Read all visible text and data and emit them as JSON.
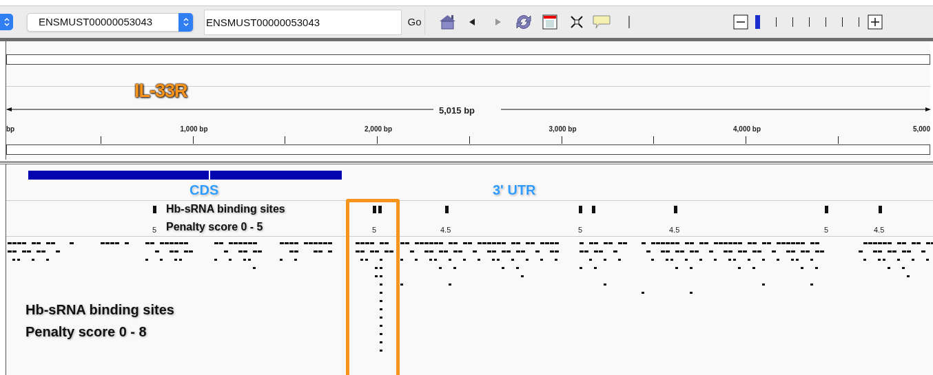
{
  "toolbar": {
    "locus_select": "ENSMUST00000053043",
    "search": {
      "value": "ENSMUST00000053043"
    },
    "go_button": "Go",
    "zoom_slider": {
      "level": 0
    }
  },
  "ruler": {
    "annotation": "IL-33R",
    "span": "5,015 bp",
    "tick_labels": [
      "bp",
      "1,000 bp",
      "2,000 bp",
      "3,000 bp",
      "4,000 bp",
      "5,000"
    ]
  },
  "gene_track": {
    "labels": [
      "CDS",
      "3' UTR"
    ]
  },
  "sites_track": {
    "label_lines": [
      "Hb-sRNA binding sites",
      "Penalty score 0 - 5"
    ],
    "scores": [
      "5",
      "5",
      "4.5",
      "5",
      "4.5",
      "5",
      "4.5"
    ]
  },
  "features_track": {
    "label_lines": [
      "Hb-sRNA binding sites",
      "Penalty score 0 - 8"
    ]
  }
}
